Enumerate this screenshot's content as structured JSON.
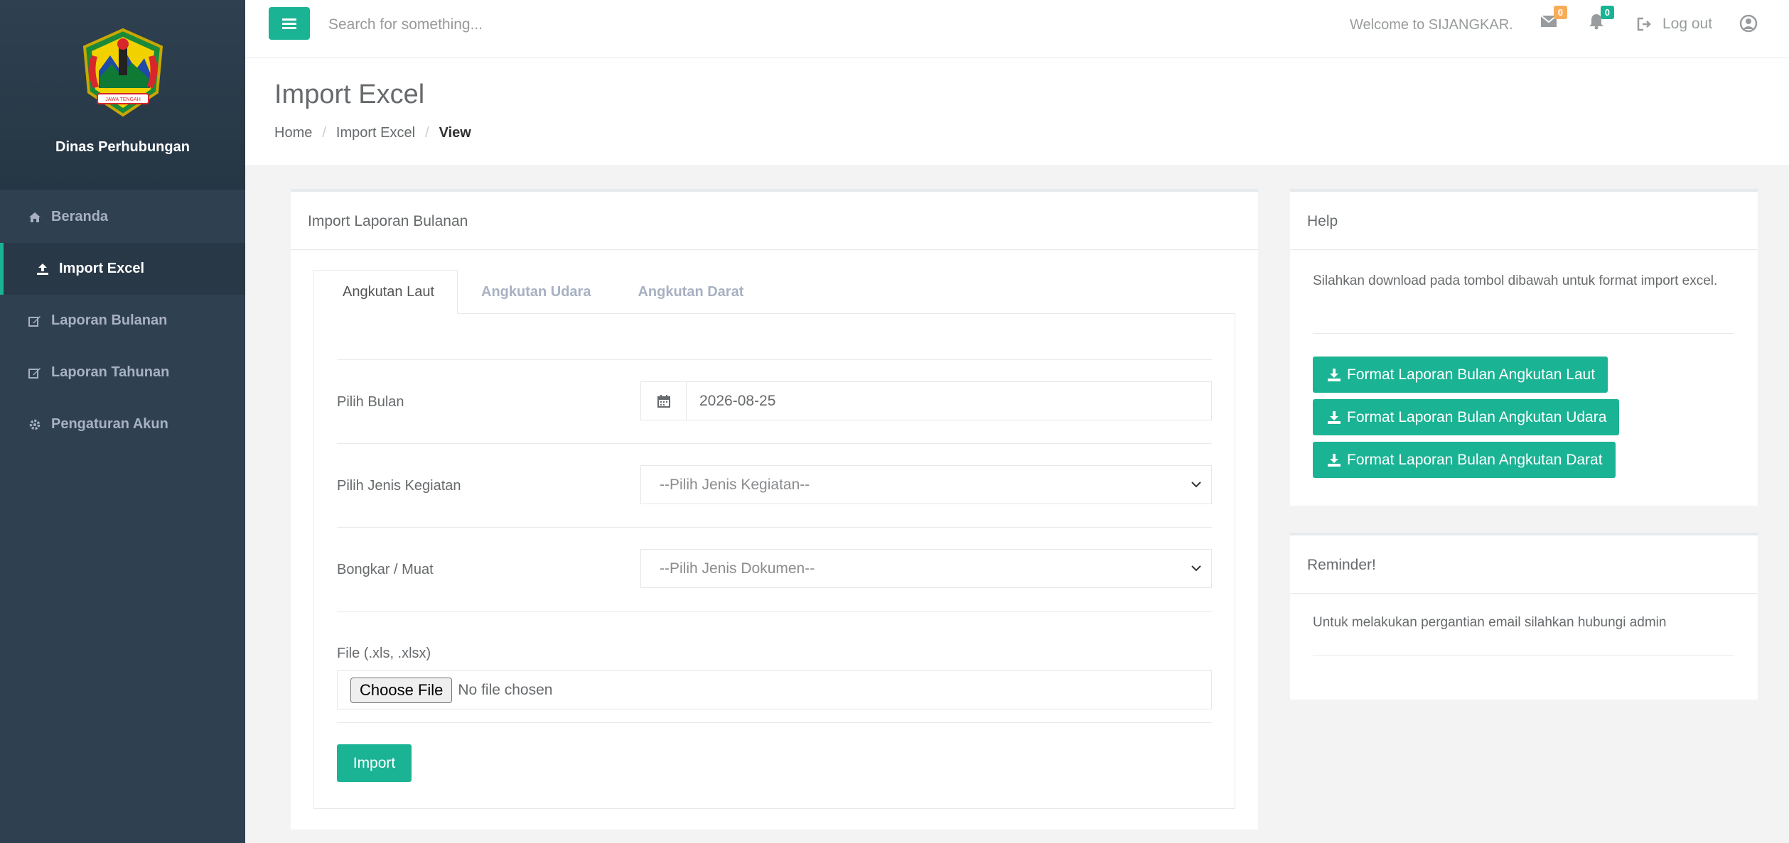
{
  "sidebar": {
    "org_name": "Dinas Perhubungan",
    "logo_text": "JAWA TENGAH",
    "items": [
      {
        "label": "Beranda",
        "icon": "home-icon"
      },
      {
        "label": "Import Excel",
        "icon": "upload-icon",
        "active": true
      },
      {
        "label": "Laporan Bulanan",
        "icon": "edit-icon"
      },
      {
        "label": "Laporan Tahunan",
        "icon": "edit-icon"
      },
      {
        "label": "Pengaturan Akun",
        "icon": "gear-icon"
      }
    ]
  },
  "topbar": {
    "search_placeholder": "Search for something...",
    "welcome": "Welcome to SIJANGKAR.",
    "messages_count": "0",
    "notifications_count": "0",
    "logout_label": "Log out"
  },
  "page": {
    "title": "Import Excel",
    "breadcrumb": [
      "Home",
      "Import Excel",
      "View"
    ]
  },
  "import_panel": {
    "title": "Import Laporan Bulanan",
    "tabs": [
      "Angkutan Laut",
      "Angkutan Udara",
      "Angkutan Darat"
    ],
    "fields": {
      "month_label": "Pilih Bulan",
      "month_value": "2026-08-25",
      "activity_label": "Pilih Jenis Kegiatan",
      "activity_value": "--Pilih Jenis Kegiatan--",
      "loading_label": "Bongkar / Muat",
      "loading_value": "--Pilih Jenis Dokumen--",
      "file_label": "File (.xls, .xlsx)",
      "file_button": "Choose File",
      "file_status": "No file chosen"
    },
    "import_button": "Import"
  },
  "help_panel": {
    "title": "Help",
    "text": "Silahkan download pada tombol dibawah untuk format import excel.",
    "buttons": [
      "Format Laporan Bulan Angkutan Laut",
      "Format Laporan Bulan Angkutan Udara",
      "Format Laporan Bulan Angkutan Darat"
    ]
  },
  "reminder_panel": {
    "title": "Reminder!",
    "text": "Untuk melakukan pergantian email silahkan hubungi admin"
  },
  "colors": {
    "sidebar_bg": "#2f4050",
    "accent": "#1ab394",
    "badge_warning": "#f8ac59"
  }
}
